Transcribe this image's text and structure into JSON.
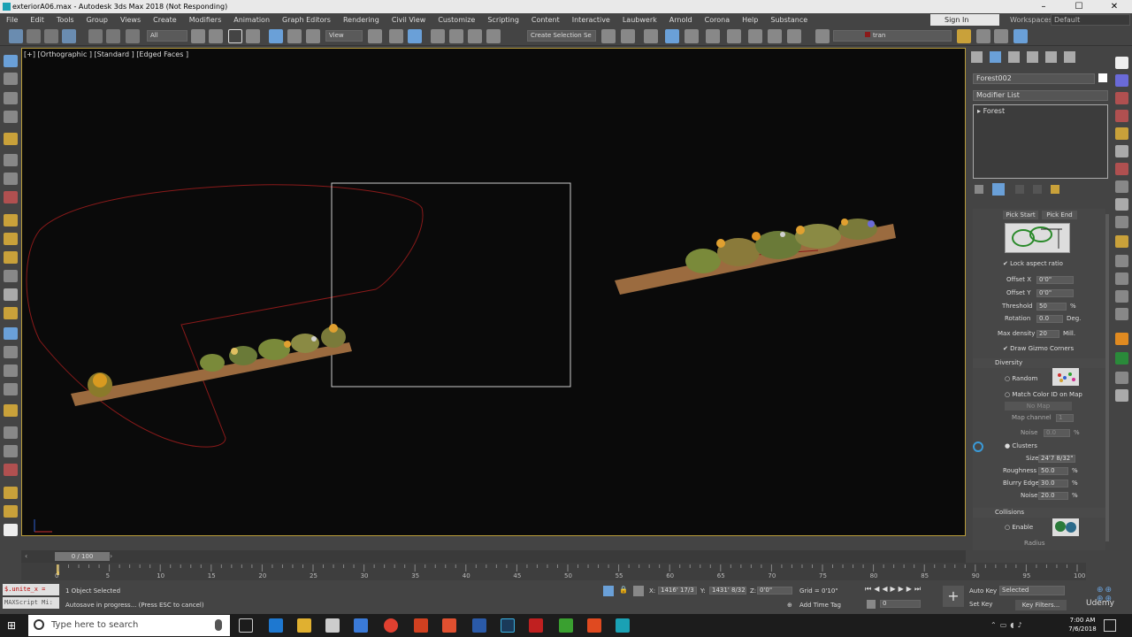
{
  "window": {
    "title": "exteriorA06.max - Autodesk 3ds Max 2018  (Not Responding)",
    "controls": [
      "–",
      "☐",
      "✕"
    ]
  },
  "menu": [
    "File",
    "Edit",
    "Tools",
    "Group",
    "Views",
    "Create",
    "Modifiers",
    "Animation",
    "Graph Editors",
    "Rendering",
    "Civil View",
    "Customize",
    "Scripting",
    "Content",
    "Interactive",
    "Laubwerk",
    "Arnold",
    "Corona",
    "Help",
    "Substance"
  ],
  "account": {
    "signin": "Sign In",
    "workspaces_label": "Workspaces:",
    "workspace": "Default"
  },
  "toolbar": {
    "filter": "All",
    "ref_coord": "View",
    "selection_set": "Create Selection Se",
    "layer": "tran"
  },
  "viewport": {
    "label": "[+] [Orthographic ] [Standard ] [Edged Faces ]"
  },
  "command_panel": {
    "object_name": "Forest002",
    "modifier_list": "Modifier List",
    "stack_item": "Forest",
    "pick_start": "Pick Start",
    "pick_end": "Pick End",
    "lock_aspect": "Lock aspect ratio",
    "params": [
      {
        "label": "Offset X",
        "value": "0'0\"",
        "unit": ""
      },
      {
        "label": "Offset Y",
        "value": "0'0\"",
        "unit": ""
      },
      {
        "label": "Threshold",
        "value": "50",
        "unit": "%"
      },
      {
        "label": "Rotation",
        "value": "0.0",
        "unit": "Deg."
      },
      {
        "label": "Max density",
        "value": "20",
        "unit": "Mill."
      }
    ],
    "draw_gizmo": "Draw Gizmo Corners",
    "diversity": {
      "title": "Diversity",
      "random": "Random",
      "match_color": "Match Color ID on Map",
      "no_map": "No Map",
      "map_channel": "Map channel",
      "map_channel_value": "1",
      "noise": "Noise",
      "noise_value": "0.0",
      "clusters": "Clusters",
      "size_label": "Size",
      "size_value": "24'7 8/32\"",
      "roughness_label": "Roughness",
      "roughness_value": "50.0",
      "blurry_label": "Blurry Edge",
      "blurry_value": "30.0",
      "noise2_label": "Noise",
      "noise2_value": "20.0",
      "pct": "%"
    },
    "collisions": {
      "title": "Collisions",
      "enable": "Enable",
      "radius": "Radius"
    }
  },
  "timeline": {
    "frame": "0 / 100",
    "ticks": [
      "0",
      "5",
      "10",
      "15",
      "20",
      "25",
      "30",
      "35",
      "40",
      "45",
      "50",
      "55",
      "60",
      "65",
      "70",
      "75",
      "80",
      "85",
      "90",
      "95",
      "100"
    ]
  },
  "status": {
    "script1": "$.unite_x = ",
    "script2": "MAXScript Mi:",
    "selected": "1 Object Selected",
    "autosave": "Autosave in progress... (Press ESC to cancel)",
    "x_label": "X:",
    "x_value": "1416' 17/3",
    "y_label": "Y:",
    "y_value": "1431' 8/32",
    "z_label": "Z:",
    "z_value": "0'0\"",
    "grid": "Grid = 0'10\"",
    "add_time_tag": "Add Time Tag",
    "auto_key": "Auto Key",
    "set_key": "Set Key",
    "key_mode": "Selected",
    "key_filters": "Key Filters...",
    "frame_value": "0"
  },
  "taskbar": {
    "search": "Type here to search",
    "time": "7:00 AM",
    "date": "7/6/2018"
  },
  "watermark": "Udemy"
}
